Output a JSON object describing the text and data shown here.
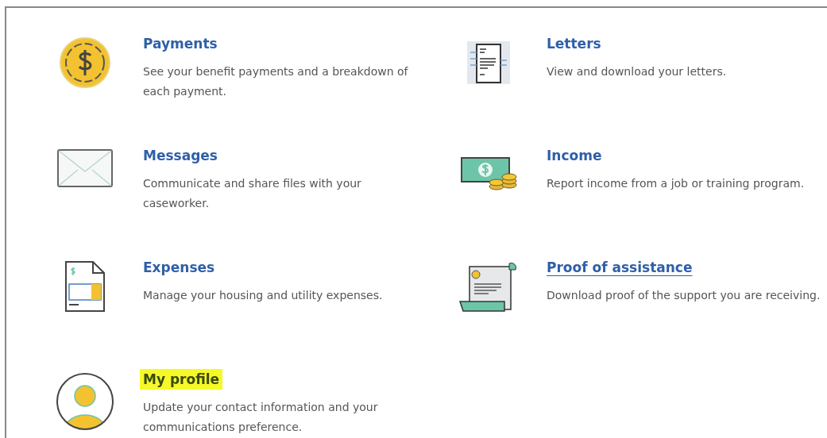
{
  "items": [
    {
      "title": "Payments",
      "description": "See your benefit payments and a breakdown of each payment.",
      "underlined": false,
      "highlighted": false
    },
    {
      "title": "Letters",
      "description": "View and download your letters.",
      "underlined": false,
      "highlighted": false
    },
    {
      "title": "Messages",
      "description": "Communicate and share files with your caseworker.",
      "underlined": false,
      "highlighted": false
    },
    {
      "title": "Income",
      "description": "Report income from a job or training program.",
      "underlined": false,
      "highlighted": false
    },
    {
      "title": "Expenses",
      "description": "Manage your housing and utility expenses.",
      "underlined": false,
      "highlighted": false
    },
    {
      "title": "Proof of assistance",
      "description": "Download proof of the support you are receiving.",
      "underlined": true,
      "highlighted": false
    },
    {
      "title": "My profile",
      "description": "Update your contact information and your communications preference.",
      "underlined": false,
      "highlighted": true
    }
  ]
}
